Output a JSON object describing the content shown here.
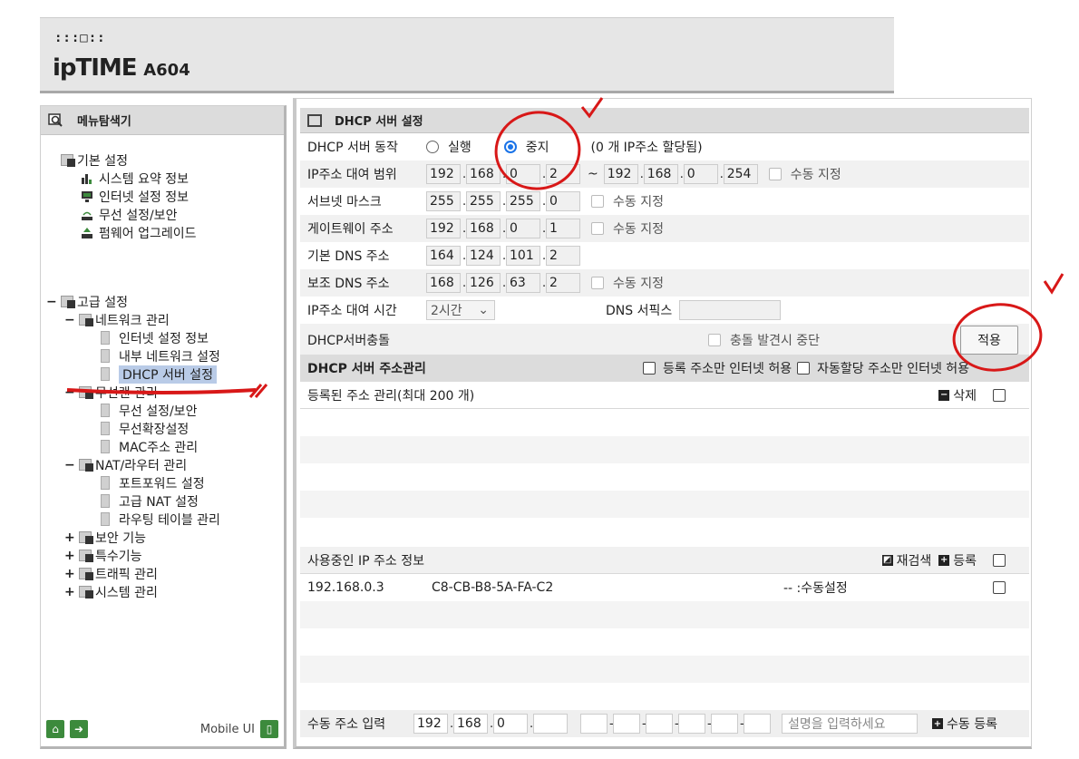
{
  "header": {
    "logo_dots": ":::□::",
    "brand": "ipTIME",
    "model": "A604"
  },
  "sidebar": {
    "title": "메뉴탐색기",
    "basic": {
      "label": "기본 설정",
      "items": [
        "시스템 요약 정보",
        "인터넷 설정 정보",
        "무선 설정/보안",
        "펌웨어 업그레이드"
      ]
    },
    "advanced": {
      "label": "고급 설정"
    },
    "network": {
      "label": "네트워크 관리",
      "items": [
        "인터넷 설정 정보",
        "내부 네트워크 설정",
        "DHCP 서버 설정"
      ]
    },
    "wireless": {
      "label": "무선랜 관리",
      "items": [
        "무선 설정/보안",
        "무선확장설정",
        "MAC주소 관리"
      ]
    },
    "nat": {
      "label": "NAT/라우터 관리",
      "items": [
        "포트포워드 설정",
        "고급 NAT 설정",
        "라우팅 테이블 관리"
      ]
    },
    "others": [
      "보안 기능",
      "특수기능",
      "트래픽 관리",
      "시스템 관리"
    ],
    "mobile_ui": "Mobile UI"
  },
  "main": {
    "title": "DHCP 서버 설정",
    "dhcp_action": {
      "label": "DHCP 서버 동작",
      "opt_run": "실행",
      "opt_stop": "중지",
      "selected": "중지",
      "info": "(0 개 IP주소 할당됨)"
    },
    "range": {
      "label": "IP주소 대여 범위",
      "start": [
        "192",
        "168",
        "0",
        "2"
      ],
      "tilde": "~",
      "end": [
        "192",
        "168",
        "0",
        "254"
      ],
      "manual": "수동 지정"
    },
    "subnet": {
      "label": "서브넷 마스크",
      "ip": [
        "255",
        "255",
        "255",
        "0"
      ],
      "manual": "수동 지정"
    },
    "gateway": {
      "label": "게이트웨이 주소",
      "ip": [
        "192",
        "168",
        "0",
        "1"
      ],
      "manual": "수동 지정"
    },
    "dns1": {
      "label": "기본 DNS 주소",
      "ip": [
        "164",
        "124",
        "101",
        "2"
      ]
    },
    "dns2": {
      "label": "보조 DNS 주소",
      "ip": [
        "168",
        "126",
        "63",
        "2"
      ],
      "manual": "수동 지정"
    },
    "lease": {
      "label": "IP주소 대여 시간",
      "value": "2시간",
      "dns_suffix_label": "DNS 서픽스"
    },
    "conflict": {
      "label": "DHCP서버충돌",
      "stop_on_conflict": "충돌 발견시 중단",
      "apply": "적용"
    },
    "addr_mgmt": {
      "title": "DHCP 서버 주소관리",
      "only_registered": "등록 주소만 인터넷 허용",
      "only_auto": "자동할당 주소만 인터넷 허용"
    },
    "registered": {
      "title": "등록된 주소 관리(최대 200 개)",
      "delete": "삭제"
    },
    "in_use": {
      "title": "사용중인 IP 주소 정보",
      "rescan": "재검색",
      "register": "등록",
      "rows": [
        {
          "ip": "192.168.0.3",
          "mac": "C8-CB-B8-5A-FA-C2",
          "desc": "-- :수동설정"
        }
      ]
    },
    "manual": {
      "label": "수동 주소 입력",
      "ip": [
        "192",
        "168",
        "0",
        ""
      ],
      "placeholder": "설명을 입력하세요",
      "register": "수동 등록"
    }
  }
}
